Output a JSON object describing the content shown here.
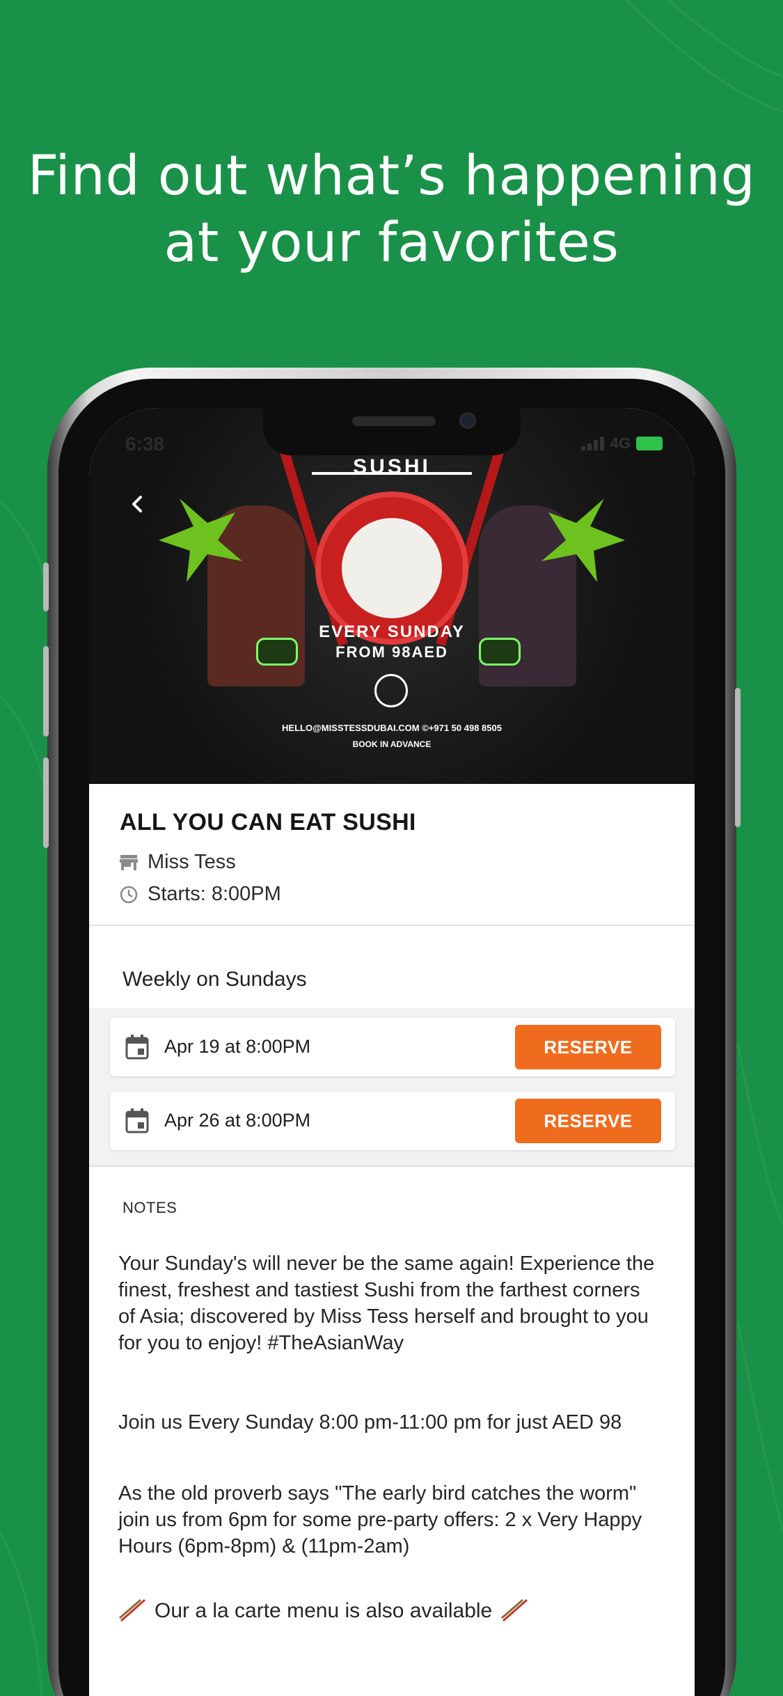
{
  "headline": {
    "line1": "Find out what’s happening",
    "line2": "at your favorites"
  },
  "status_bar": {
    "time": "6:38",
    "network": "4G"
  },
  "hero": {
    "brand_text": "SUSHI",
    "promo_line1": "EVERY SUNDAY",
    "promo_line2": "FROM 98AED",
    "contact": "HELLO@MISSTESSDUBAI.COM ©+971 50 498 8505",
    "book_note": "BOOK IN ADVANCE"
  },
  "event": {
    "title": "ALL YOU CAN EAT SUSHI",
    "venue": "Miss Tess",
    "starts": "Starts: 8:00PM"
  },
  "schedule": {
    "recurrence": "Weekly on Sundays",
    "dates": [
      {
        "label": "Apr 19 at 8:00PM",
        "action": "RESERVE"
      },
      {
        "label": "Apr 26 at 8:00PM",
        "action": "RESERVE"
      }
    ]
  },
  "notes": {
    "label": "NOTES",
    "paragraphs": [
      "Your Sunday's will never be the same again! Experience the finest, freshest and tastiest Sushi from the farthest corners of Asia; discovered by Miss Tess herself and brought to you for you to enjoy! #TheAsianWay",
      "Join us Every Sunday 8:00 pm-11:00 pm for just AED 98",
      "As the old proverb says \"The early bird catches the worm\" join us from 6pm for some pre-party offers: 2 x Very Happy Hours (6pm-8pm) & (11pm-2am)"
    ],
    "carte_line": "Our a la carte menu is also available"
  },
  "colors": {
    "background": "#1a9148",
    "accent": "#ef6c1f",
    "text": "#161616"
  }
}
